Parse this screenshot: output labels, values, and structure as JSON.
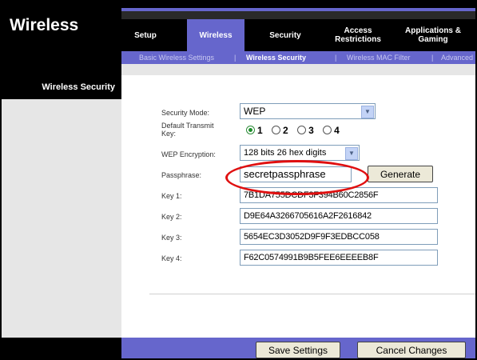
{
  "header": {
    "title": "Wireless",
    "tabs": [
      {
        "label": "Setup",
        "active": false
      },
      {
        "label": "Wireless",
        "active": true
      },
      {
        "label": "Security",
        "active": false
      },
      {
        "label": "Access Restrictions",
        "active": false
      },
      {
        "label": "Applications & Gaming",
        "active": false
      }
    ],
    "subnav": [
      {
        "label": "Basic Wireless Settings",
        "active": false
      },
      {
        "label": "|",
        "active": false
      },
      {
        "label": "Wireless Security",
        "active": true
      },
      {
        "label": "|",
        "active": false
      },
      {
        "label": "Wireless MAC Filter",
        "active": false
      },
      {
        "label": "|",
        "active": false
      },
      {
        "label": "Advanced",
        "active": false
      }
    ]
  },
  "sidebar": {
    "section_label": "Wireless Security"
  },
  "form": {
    "security_mode_label": "Security Mode:",
    "security_mode_value": "WEP",
    "default_key_label": "Default Transmit Key:",
    "default_key_options": [
      "1",
      "2",
      "3",
      "4"
    ],
    "default_key_selected": "1",
    "wep_encryption_label": "WEP Encryption:",
    "wep_encryption_value": "128 bits 26 hex digits",
    "passphrase_label": "Passphrase:",
    "passphrase_value": "secretpassphrase",
    "generate_label": "Generate",
    "keys": [
      {
        "label": "Key 1:",
        "value": "7B1DA755DCDF3F394B60C2856F"
      },
      {
        "label": "Key 2:",
        "value": "D9E64A3266705616A2F2616842"
      },
      {
        "label": "Key 3:",
        "value": "5654EC3D3052D9F9F3EDBCC058"
      },
      {
        "label": "Key 4:",
        "value": "F62C0574991B9B5FEE6EEEEB8F"
      }
    ]
  },
  "footer": {
    "save_label": "Save Settings",
    "cancel_label": "Cancel Changes"
  },
  "colors": {
    "accent": "#6666cc",
    "highlight_ring": "#e01010"
  }
}
